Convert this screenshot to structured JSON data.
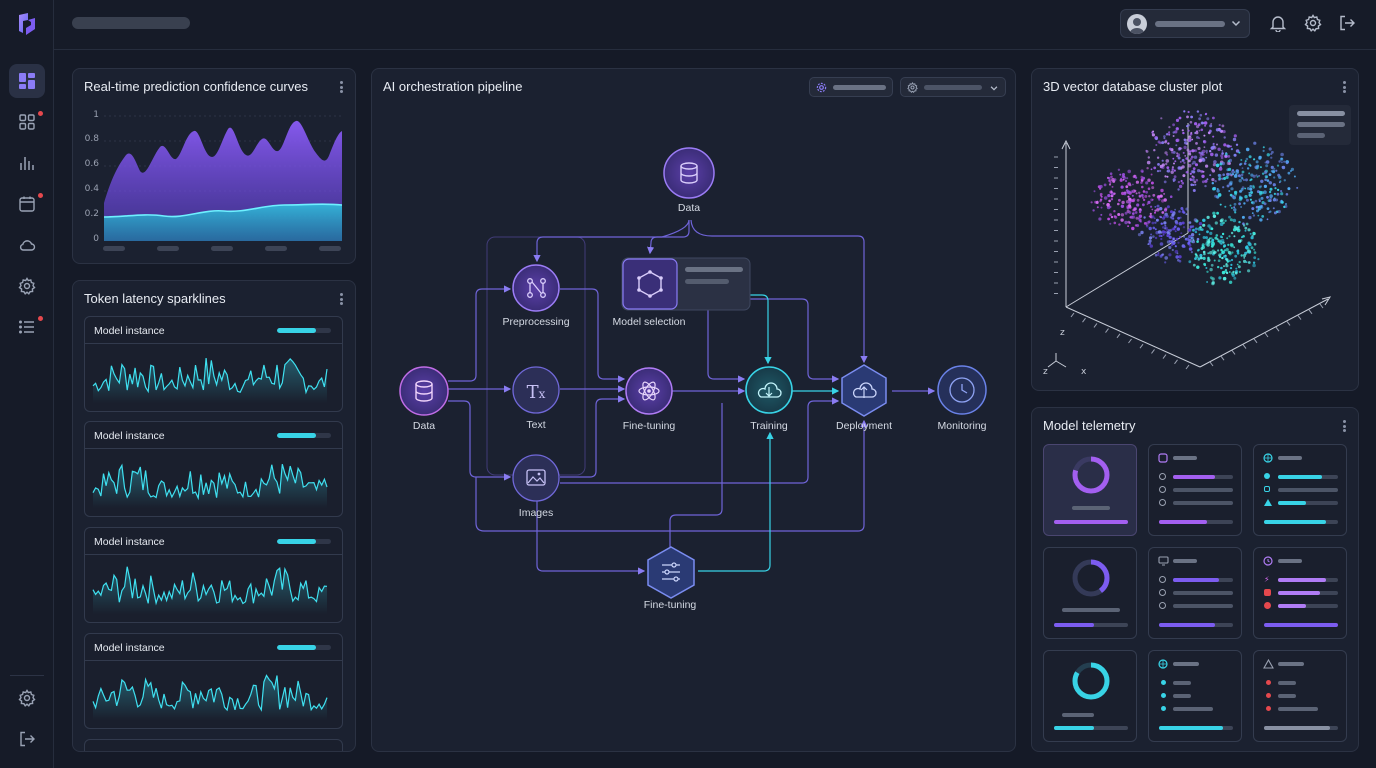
{
  "panels": {
    "confidence": {
      "title": "Real-time prediction confidence curves",
      "y_ticks": [
        "1",
        "0.8",
        "0.6",
        "0.4",
        "0.2",
        "0"
      ]
    },
    "latency": {
      "title": "Token latency sparklines",
      "cards": [
        {
          "label": "Model instance",
          "progress": 0.72
        },
        {
          "label": "Model instance",
          "progress": 0.72
        },
        {
          "label": "Model instance",
          "progress": 0.72
        },
        {
          "label": "Model instance",
          "progress": 0.72
        }
      ]
    },
    "pipeline": {
      "title": "AI orchestration pipeline",
      "nodes": {
        "data_top": "Data",
        "preprocessing": "Preprocessing",
        "model_selection": "Model selection",
        "data_left": "Data",
        "text": "Text",
        "fine_tuning_mid": "Fine-tuning",
        "training": "Training",
        "deployment": "Deployment",
        "monitoring": "Monitoring",
        "images": "Images",
        "fine_tuning_bottom": "Fine-tuning"
      }
    },
    "vector_db": {
      "title": "3D vector database cluster plot",
      "axes": {
        "x": "x",
        "z": "z"
      }
    },
    "telemetry": {
      "title": "Model telemetry"
    }
  },
  "colors": {
    "accent_purple": "#8b5cf6",
    "accent_cyan": "#38d3e6",
    "alert_red": "#e5484d",
    "panel_bg": "#1b2130"
  },
  "icons": {
    "sidebar": [
      "dashboard-icon",
      "apps-icon",
      "bar-chart-icon",
      "calendar-icon",
      "cloud-icon",
      "settings-icon",
      "list-icon",
      "settings-icon",
      "logout-icon"
    ],
    "topbar": [
      "bell-icon",
      "gear-icon",
      "logout-icon"
    ]
  }
}
